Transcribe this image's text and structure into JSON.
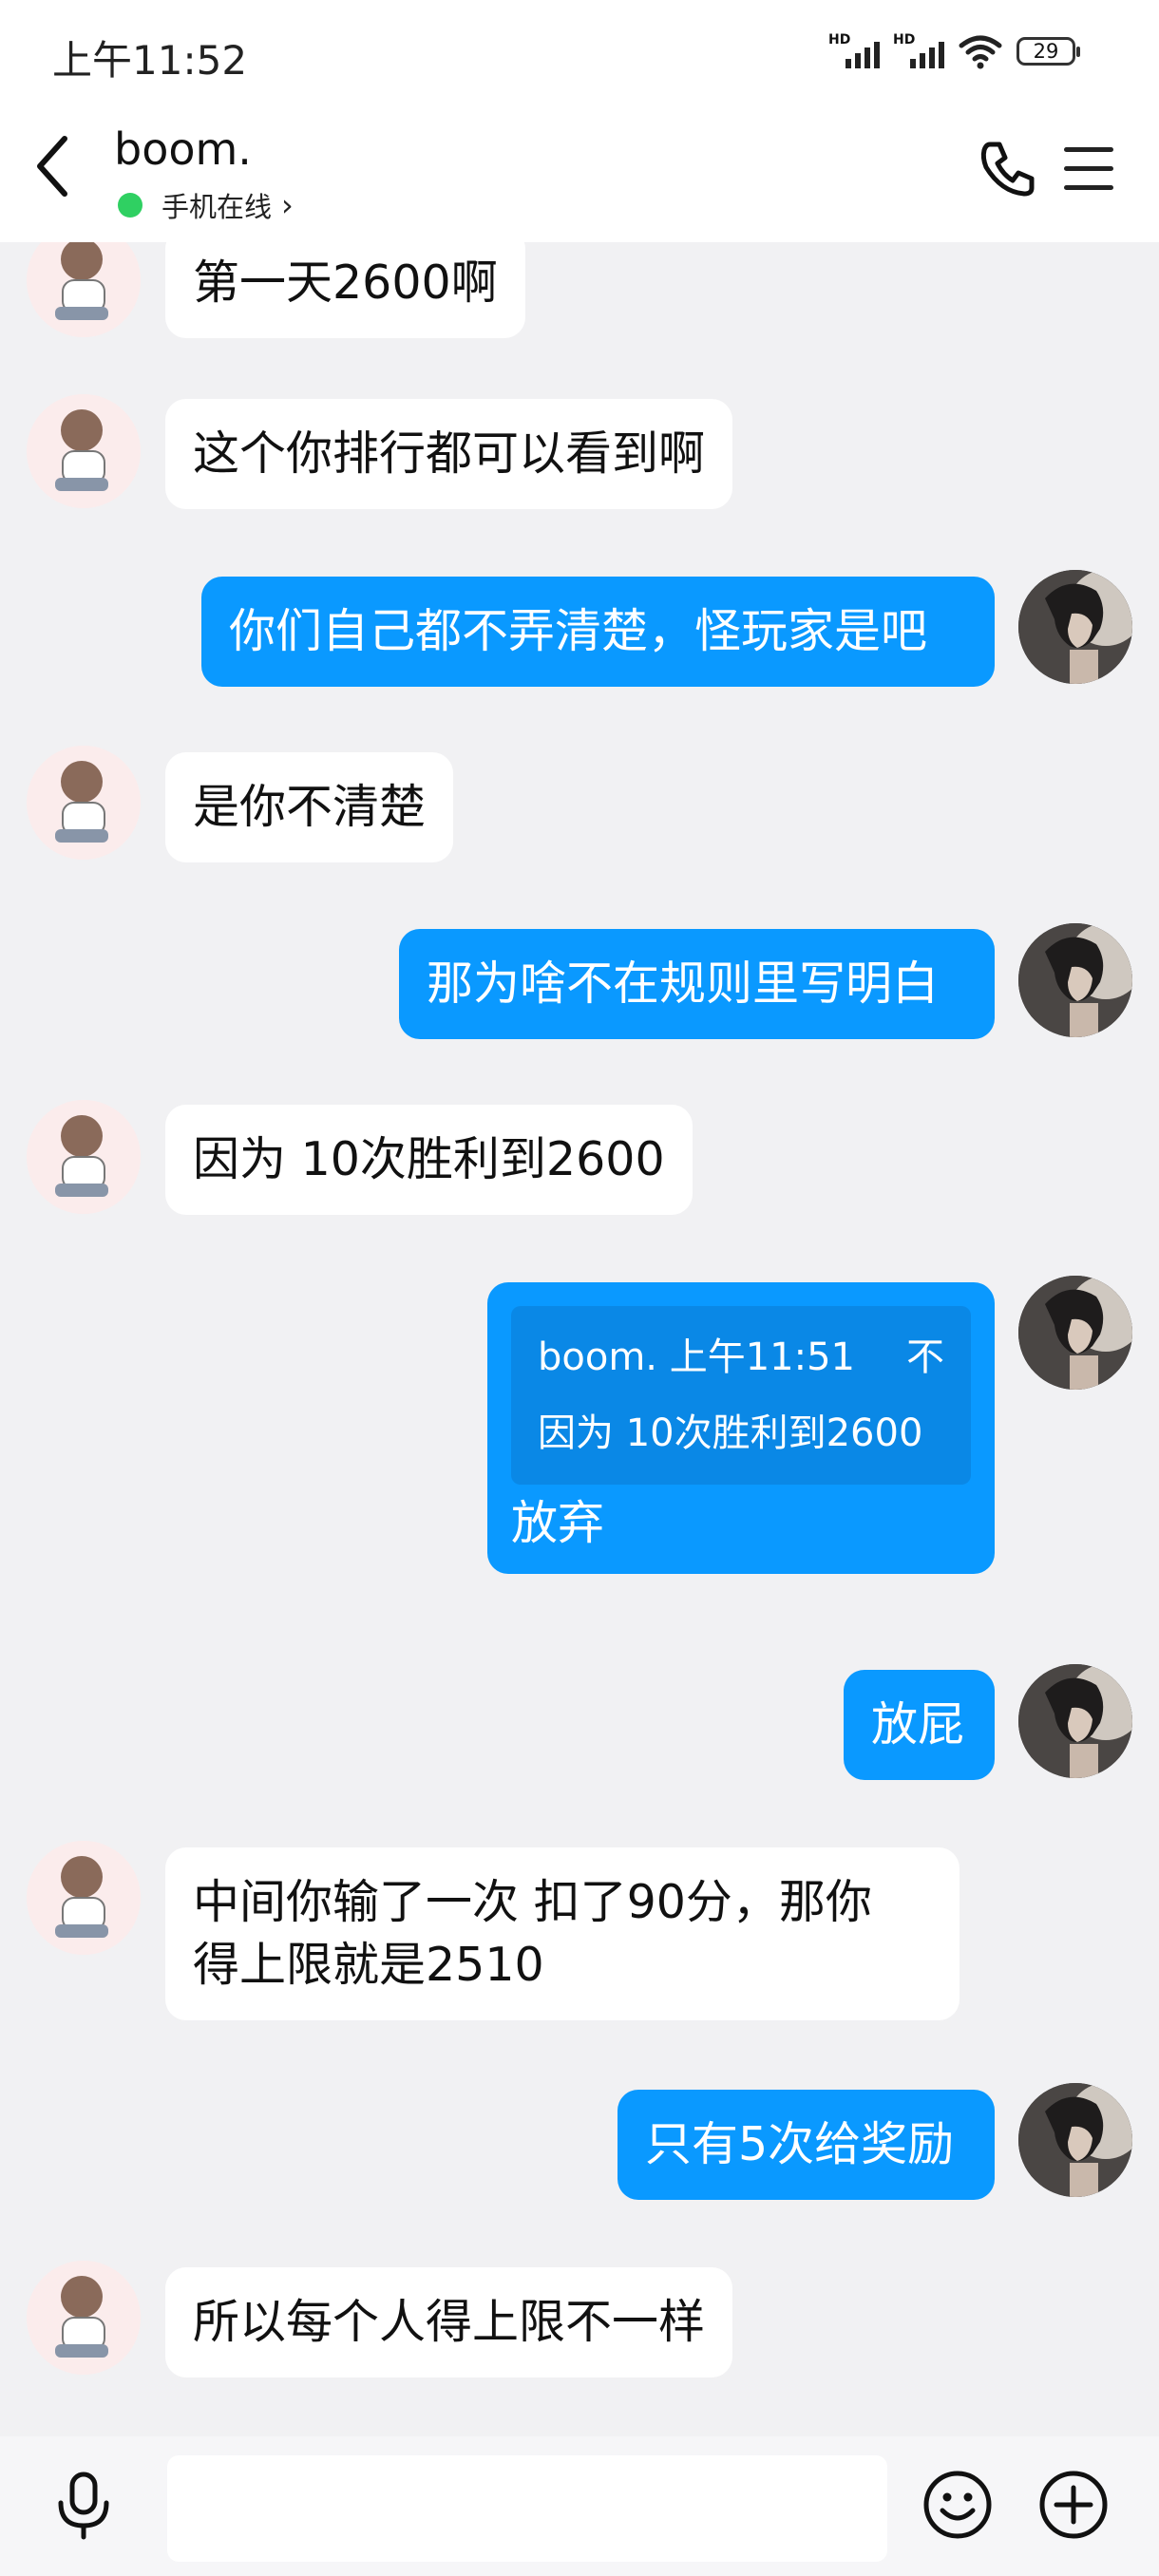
{
  "status_bar": {
    "time": "上午11:52",
    "battery": "29",
    "hd": "HD"
  },
  "header": {
    "name": "boom.",
    "status": "手机在线"
  },
  "messages": [
    {
      "side": "in",
      "text": "第一天2600啊"
    },
    {
      "side": "in",
      "text": "这个你排行都可以看到啊"
    },
    {
      "side": "out",
      "text": "你们自己都不弄清楚，怪玩家是吧"
    },
    {
      "side": "in",
      "text": "是你不清楚"
    },
    {
      "side": "out",
      "text": "那为啥不在规则里写明白"
    },
    {
      "side": "in",
      "text": "因为 10次胜利到2600"
    },
    {
      "side": "out",
      "quote_sender": "boom. 上午11:51",
      "quote_tail": "不",
      "quote_text": "因为 10次胜利到2600",
      "text": "放弃"
    },
    {
      "side": "out",
      "text": "放屁"
    },
    {
      "side": "in",
      "text_line1": "中间你输了一次 扣了90分，那你",
      "text_line2": "得上限就是2510"
    },
    {
      "side": "out",
      "text": "只有5次给奖励"
    },
    {
      "side": "in",
      "text": "所以每个人得上限不一样"
    }
  ],
  "input": {
    "placeholder": ""
  },
  "icons": {
    "back": "chevron-left-icon",
    "call": "phone-icon",
    "menu": "menu-icon",
    "voice": "microphone-icon",
    "emoji": "emoji-icon",
    "more": "plus-icon"
  },
  "colors": {
    "outgoing_bubble": "#0a99ff",
    "incoming_bubble": "#ffffff",
    "online_dot": "#2fd062",
    "background": "#f1f1f3"
  }
}
